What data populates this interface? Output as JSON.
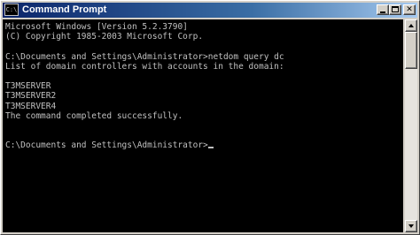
{
  "window": {
    "title": "Command Prompt",
    "icon": "command-prompt-icon",
    "icon_glyph": "C:\\"
  },
  "title_buttons": {
    "minimize_icon": "minimize-icon",
    "maximize_icon": "maximize-icon",
    "close_glyph": "✕"
  },
  "console": {
    "lines": [
      "Microsoft Windows [Version 5.2.3790]",
      "(C) Copyright 1985-2003 Microsoft Corp.",
      "",
      "C:\\Documents and Settings\\Administrator>netdom query dc",
      "List of domain controllers with accounts in the domain:",
      "",
      "T3MSERVER",
      "T3MSERVER2",
      "T3MSERVER4",
      "The command completed successfully.",
      "",
      "",
      "C:\\Documents and Settings\\Administrator>"
    ]
  },
  "colors": {
    "console_bg": "#000000",
    "console_text": "#c0c0c0",
    "titlebar_start": "#0a246a",
    "titlebar_end": "#a6caf0"
  }
}
